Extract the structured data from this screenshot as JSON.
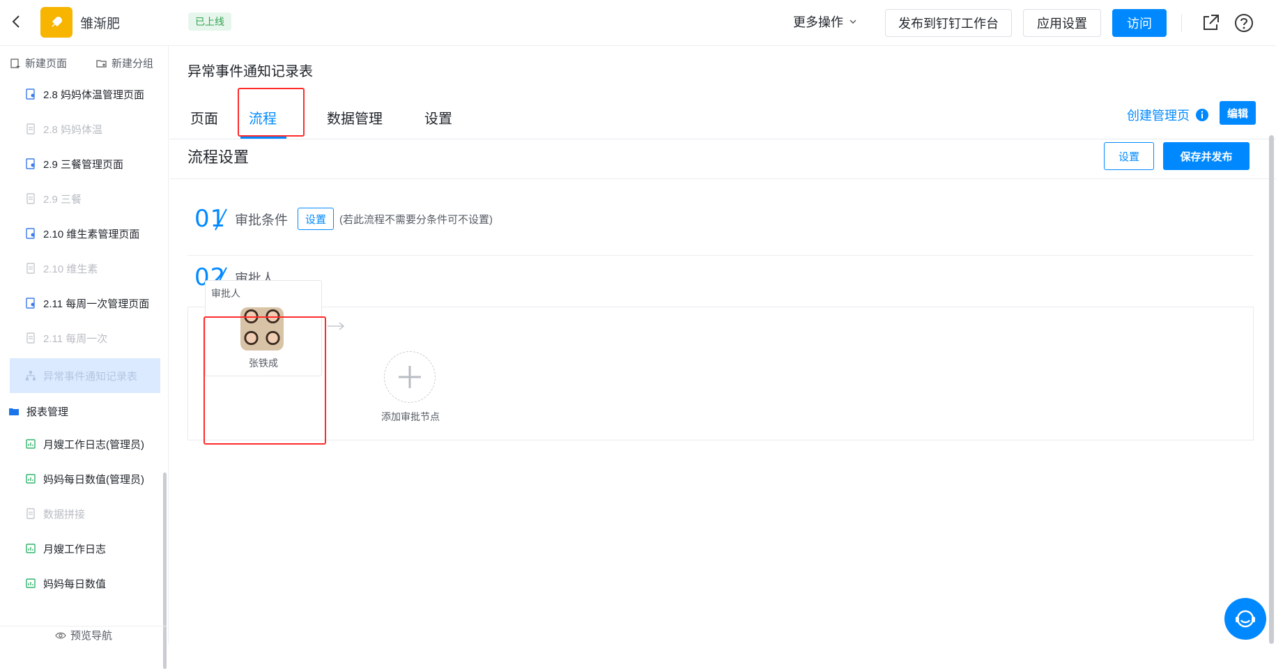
{
  "header": {
    "app_name": "雏渐肥",
    "status": "已上线",
    "more_ops": "更多操作",
    "publish_dingtalk": "发布到钉钉工作台",
    "app_settings": "应用设置",
    "visit": "访问"
  },
  "sidebar": {
    "new_page": "新建页面",
    "new_group": "新建分组",
    "items": [
      {
        "label": "2.8 妈妈体温管理页面",
        "state": "normal"
      },
      {
        "label": "2.8 妈妈体温",
        "state": "disabled"
      },
      {
        "label": "2.9 三餐管理页面",
        "state": "normal"
      },
      {
        "label": "2.9 三餐",
        "state": "disabled"
      },
      {
        "label": "2.10 维生素管理页面",
        "state": "normal"
      },
      {
        "label": "2.10 维生素",
        "state": "disabled"
      },
      {
        "label": "2.11 每周一次管理页面",
        "state": "normal"
      },
      {
        "label": "2.11 每周一次",
        "state": "disabled"
      },
      {
        "label": "异常事件通知记录表",
        "state": "active"
      }
    ],
    "group_label": "报表管理",
    "group_items": [
      {
        "label": "月嫂工作日志(管理员)",
        "state": "normal"
      },
      {
        "label": "妈妈每日数值(管理员)",
        "state": "normal"
      },
      {
        "label": "数据拼接",
        "state": "disabled"
      },
      {
        "label": "月嫂工作日志",
        "state": "normal"
      },
      {
        "label": "妈妈每日数值",
        "state": "normal"
      }
    ],
    "footer": "预览导航"
  },
  "main": {
    "title": "异常事件通知记录表",
    "tabs": [
      "页面",
      "流程",
      "数据管理",
      "设置"
    ],
    "active_tab": "流程",
    "create_admin_page": "创建管理页",
    "edit": "编辑",
    "section_title": "流程设置",
    "settings_btn": "设置",
    "save_publish": "保存并发布",
    "step1": {
      "num": "01",
      "title": "审批条件",
      "btn": "设置",
      "hint": "(若此流程不需要分条件可不设置)"
    },
    "step2": {
      "num": "02",
      "title": "审批人"
    },
    "approver_card": {
      "label": "审批人",
      "name": "张铁成"
    },
    "add_node_label": "添加审批节点"
  },
  "colors": {
    "primary": "#0089ff",
    "highlight": "#ff2a2a",
    "status_green": "#2ea44f",
    "logo": "#f7b500"
  }
}
